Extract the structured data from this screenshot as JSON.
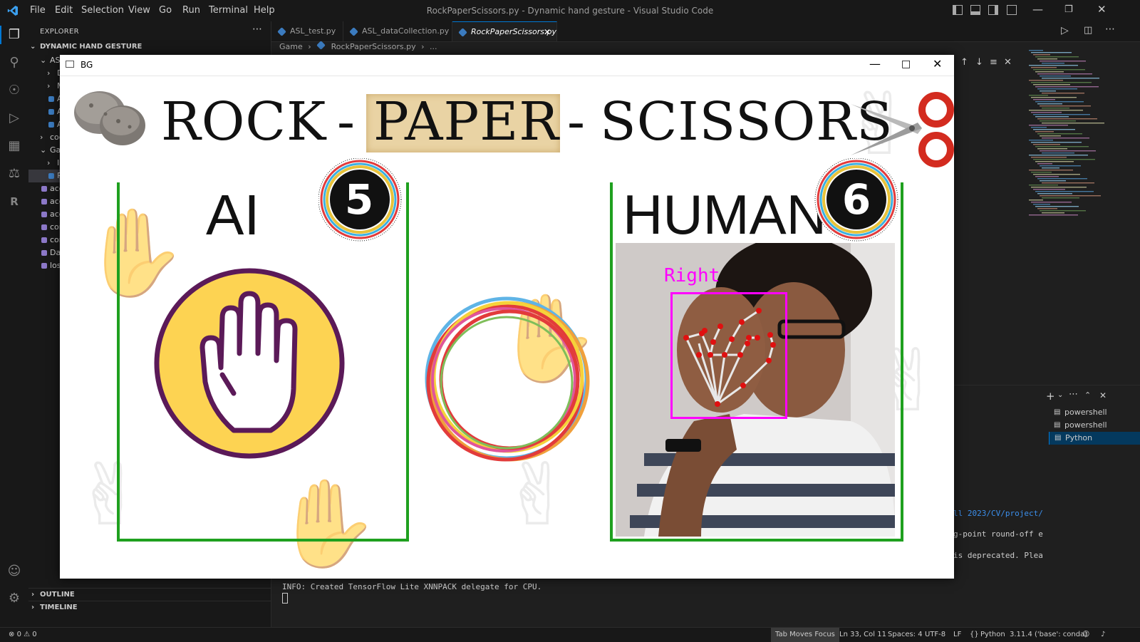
{
  "window": {
    "title": "RockPaperScissors.py - Dynamic hand gesture - Visual Studio Code"
  },
  "menu": [
    "File",
    "Edit",
    "Selection",
    "View",
    "Go",
    "Run",
    "Terminal",
    "Help"
  ],
  "explorer": {
    "header": "EXPLORER",
    "folder": "DYNAMIC HAND GESTURE",
    "rows": [
      {
        "label": "ASL",
        "indent": 1,
        "chev": "v"
      },
      {
        "label": "Da",
        "indent": 2,
        "chev": ">"
      },
      {
        "label": "M",
        "indent": 2,
        "chev": ">"
      },
      {
        "label": "AS",
        "indent": 2,
        "chev": ""
      },
      {
        "label": "AS",
        "indent": 2,
        "chev": ""
      },
      {
        "label": "AS",
        "indent": 2,
        "chev": ""
      },
      {
        "label": "cod",
        "indent": 1,
        "chev": ">"
      },
      {
        "label": "Gar",
        "indent": 1,
        "chev": "v"
      },
      {
        "label": "Im",
        "indent": 2,
        "chev": ">"
      },
      {
        "label": "Ro",
        "indent": 2,
        "chev": ""
      },
      {
        "label": "acc",
        "indent": 1,
        "chev": ""
      },
      {
        "label": "acc",
        "indent": 1,
        "chev": ""
      },
      {
        "label": "acc",
        "indent": 1,
        "chev": ""
      },
      {
        "label": "con",
        "indent": 1,
        "chev": ""
      },
      {
        "label": "con",
        "indent": 1,
        "chev": ""
      },
      {
        "label": "Dat",
        "indent": 1,
        "chev": ""
      },
      {
        "label": "loss",
        "indent": 1,
        "chev": ""
      }
    ],
    "outline": "OUTLINE",
    "timeline": "TIMELINE"
  },
  "tabs": [
    {
      "label": "ASL_test.py",
      "active": false
    },
    {
      "label": "ASL_dataCollection.py",
      "active": false
    },
    {
      "label": "RockPaperScissors.py",
      "active": true
    }
  ],
  "breadcrumb": {
    "folder": "Game",
    "file": "RockPaperScissors.py",
    "more": "..."
  },
  "terminal": {
    "sessions": [
      {
        "label": "powershell",
        "selected": false
      },
      {
        "label": "powershell",
        "selected": false
      },
      {
        "label": "Python",
        "selected": true
      }
    ],
    "lines_right": [
      "ll 2023/CV/project/",
      "g-point round-off e",
      "is deprecated. Plea"
    ],
    "info": "INFO: Created TensorFlow Lite XNNPACK delegate for CPU."
  },
  "status": {
    "problems_errors": "0",
    "problems_warnings": "0",
    "tab_moves_focus": "Tab Moves Focus",
    "position": "Ln 33, Col 11",
    "spaces": "Spaces: 4",
    "encoding": "UTF-8",
    "eol": "LF",
    "language": "Python",
    "interpreter": "3.11.4 ('base': conda)"
  },
  "game": {
    "window_title": "BG",
    "title_rock": "ROCK",
    "title_dash1": "-",
    "title_paper": "PAPER",
    "title_dash2": "-",
    "title_scissors": "SCISSORS",
    "ai_label": "AI",
    "ai_score": "5",
    "human_label": "HUMAN",
    "human_score": "6",
    "hand_label": "Right",
    "ai_move_icon": "open-palm-paper-icon",
    "colors": {
      "panel_border": "#1fa01f",
      "badge_ring": "#e8c23a",
      "hand_box": "#ff00ff",
      "ai_circle": "#fdd352",
      "ai_ring": "#5b1a58"
    }
  }
}
